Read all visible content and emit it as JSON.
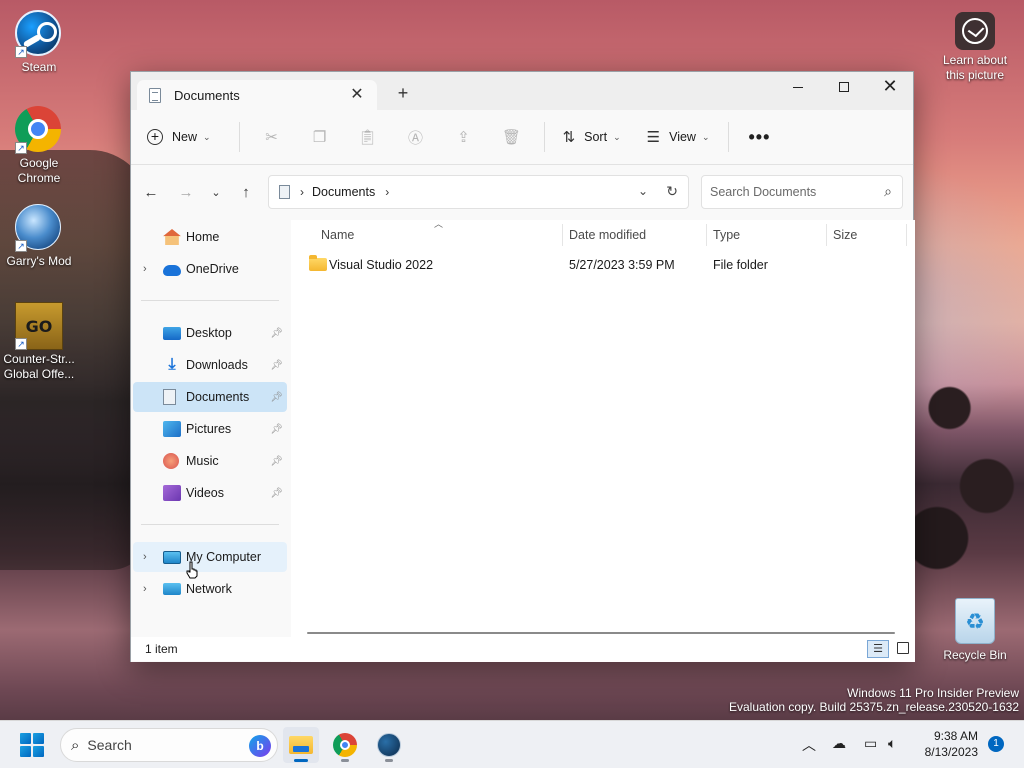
{
  "desktop": {
    "icons": [
      {
        "label": "Steam",
        "icon": "steam-icon"
      },
      {
        "label": "Google Chrome",
        "icon": "chrome-icon"
      },
      {
        "label": "Garry's Mod",
        "icon": "garrys-mod-icon"
      },
      {
        "label": "Counter-Str... Global Offe...",
        "icon": "csgo-icon",
        "badge": "GO"
      },
      {
        "label": "Recycle Bin",
        "icon": "recycle-bin-icon"
      },
      {
        "label": "Learn about this picture",
        "icon": "learn-picture-icon"
      }
    ],
    "watermark": {
      "line1": "Windows 11 Pro Insider Preview",
      "line2": "Evaluation copy. Build 25375.zn_release.230520-1632"
    }
  },
  "explorer": {
    "tab_title": "Documents",
    "tab_close": "✕",
    "new_tab": "+",
    "window_controls": {
      "close": "✕"
    },
    "toolbar": {
      "new_label": "New",
      "sort_label": "Sort",
      "view_label": "View",
      "more": "•••",
      "icons": [
        "cut-icon",
        "copy-icon",
        "paste-icon",
        "rename-icon",
        "share-icon",
        "delete-icon"
      ]
    },
    "nav_buttons": {
      "back": "←",
      "forward": "→",
      "recent": "⌄",
      "up": "↑"
    },
    "address": {
      "location": "Documents",
      "sep": "›"
    },
    "search": {
      "placeholder": "Search Documents"
    },
    "sidebar": {
      "top": [
        {
          "label": "Home",
          "icon": "home-icon"
        },
        {
          "label": "OneDrive",
          "icon": "onedrive-icon"
        }
      ],
      "quick_access": [
        {
          "label": "Desktop",
          "icon": "desktop-icon",
          "pinned": true
        },
        {
          "label": "Downloads",
          "icon": "downloads-icon",
          "pinned": true
        },
        {
          "label": "Documents",
          "icon": "documents-icon",
          "pinned": true,
          "selected": true
        },
        {
          "label": "Pictures",
          "icon": "pictures-icon",
          "pinned": true
        },
        {
          "label": "Music",
          "icon": "music-icon",
          "pinned": true
        },
        {
          "label": "Videos",
          "icon": "videos-icon",
          "pinned": true
        }
      ],
      "bottom": [
        {
          "label": "My Computer",
          "icon": "computer-icon",
          "hover": true
        },
        {
          "label": "Network",
          "icon": "network-icon"
        }
      ]
    },
    "columns": {
      "name": "Name",
      "date": "Date modified",
      "type": "Type",
      "size": "Size"
    },
    "files": [
      {
        "name": "Visual Studio 2022",
        "date": "5/27/2023 3:59 PM",
        "type": "File folder",
        "size": ""
      }
    ],
    "status": {
      "count": "1 item"
    }
  },
  "taskbar": {
    "search_placeholder": "Search",
    "apps": [
      "file-explorer-icon",
      "chrome-icon",
      "steam-icon"
    ],
    "clock": {
      "time": "9:38 AM",
      "date": "8/13/2023"
    },
    "notifications": "1"
  }
}
